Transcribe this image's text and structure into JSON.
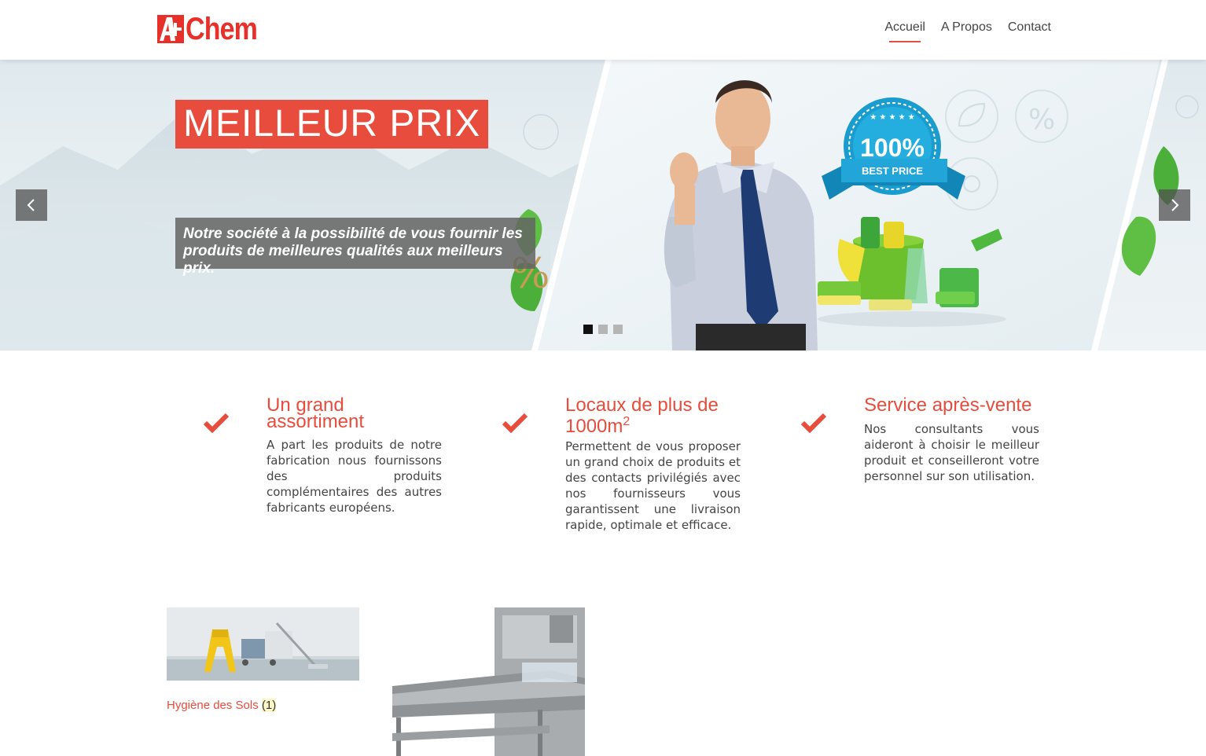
{
  "brand": {
    "logo_text": "Chem",
    "accent_color": "#e74c3c"
  },
  "nav": {
    "items": [
      {
        "label": "Accueil",
        "active": true
      },
      {
        "label": "A Propos",
        "active": false
      },
      {
        "label": "Contact",
        "active": false
      }
    ]
  },
  "hero": {
    "title": "MEILLEUR PRIX",
    "description": "Notre société à la possibilité de vous fournir les produits de meilleures qualités aux meilleurs prix.",
    "badge_percent": "100%",
    "badge_label": "BEST PRICE",
    "percent_symbol": "%",
    "slides": {
      "total": 3,
      "current": 1
    },
    "prev_icon": "chevron-left-icon",
    "next_icon": "chevron-right-icon"
  },
  "features": [
    {
      "title_line1": "Un grand",
      "title_line2": "assortiment",
      "text": "A part les produits de notre fabrication nous fournissons des produits complémentaires des autres fabricants européens.",
      "icon": "check-icon"
    },
    {
      "title_line1": "Locaux de plus de",
      "title_line2": "1000m",
      "title_sup": "2",
      "text": "Permettent de vous proposer un grand choix de produits et des contacts privilégiés avec nos fournisseurs vous garantissent une livraison rapide, optimale et efficace.",
      "icon": "check-icon"
    },
    {
      "title_line1": "Service après-vente",
      "title_line2": "",
      "text": "Nos consultants vous aideront à choisir le meilleur produit et conseilleront votre personnel sur son utilisation.",
      "icon": "check-icon"
    }
  ],
  "products": [
    {
      "name": "Hygiène des Sols",
      "count": "(1)"
    }
  ]
}
